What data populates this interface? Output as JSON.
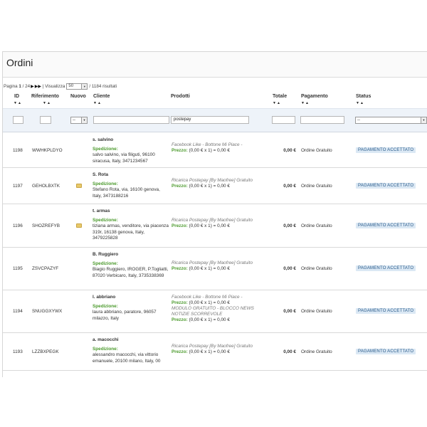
{
  "page": {
    "title": "Ordini"
  },
  "pagination": {
    "prefix": "Pagina",
    "current": "1",
    "total_suffix": "/ 24",
    "per_page_label": "| Visualizza",
    "per_page_value": "50",
    "results": "/ 1184 risultati"
  },
  "columns": {
    "id": "ID",
    "ref": "Riferimento",
    "new": "Nuovo",
    "customer": "Cliente",
    "products": "Prodotti",
    "total": "Totale",
    "payment": "Pagamento",
    "status": "Status",
    "sort_glyph": "▼▲"
  },
  "filters": {
    "new_value": "--",
    "products_value": "postepay",
    "status_value": "--"
  },
  "orders": [
    {
      "id": "1198",
      "ref": "WWHKPLDYO",
      "new": false,
      "customer_name": "s. salvino",
      "ship_label": "Spedizione:",
      "address": "salvo salvino, via filiguti, 96100 siracusa, Italy, 3471234567",
      "products": [
        {
          "name": "Facebook Like - Bottone Mi Piace -",
          "price_label": "Prezzo:",
          "price": "(0,00 € x 1) = 0,00 €"
        }
      ],
      "total": "0,00 €",
      "payment": "Ordine Gratuito",
      "status": "PAGAMENTO ACCETTATO"
    },
    {
      "id": "1197",
      "ref": "GEHOLBXTK",
      "new": true,
      "customer_name": "S. Rota",
      "ship_label": "Spedizione:",
      "address": "Stefano Rota, via, 16100 genova, Italy, 3473188216",
      "products": [
        {
          "name": "Ricarica Postepay [By Maofree] Gratuito",
          "price_label": "Prezzo:",
          "price": "(0,00 € x 1) = 0,00 €"
        }
      ],
      "total": "0,00 €",
      "payment": "Ordine Gratuito",
      "status": "PAGAMENTO ACCETTATO"
    },
    {
      "id": "1196",
      "ref": "SHOZREFYB",
      "new": true,
      "customer_name": "t. armas",
      "ship_label": "Spedizione:",
      "address": "tiziana armas, venditore, via piacenza 319r, 16138 genova, Italy, 3479225828",
      "products": [
        {
          "name": "Ricarica Postepay [By Maofree] Gratuito",
          "price_label": "Prezzo:",
          "price": "(0,00 € x 1) = 0,00 €"
        }
      ],
      "total": "0,00 €",
      "payment": "Ordine Gratuito",
      "status": "PAGAMENTO ACCETTATO"
    },
    {
      "id": "1195",
      "ref": "ZSVCPAZYF",
      "new": false,
      "customer_name": "B. Ruggiero",
      "ship_label": "Spedizione:",
      "address": "Biagio Ruggiero, IROGER, P.Togliatti, 87020 Verbicaro, Italy, 3735338369",
      "products": [
        {
          "name": "Ricarica Postepay [By Maofree] Gratuito",
          "price_label": "Prezzo:",
          "price": "(0,00 € x 1) = 0,00 €"
        }
      ],
      "total": "0,00 €",
      "payment": "Ordine Gratuito",
      "status": "PAGAMENTO ACCETTATO"
    },
    {
      "id": "1194",
      "ref": "SNUGGXYWX",
      "new": false,
      "customer_name": "l. abbriano",
      "ship_label": "Spedizione:",
      "address": "laura abbriano, paratore, 96057 milazzo, Italy",
      "products": [
        {
          "name": "Facebook Like - Bottone Mi Piace -",
          "price_label": "Prezzo:",
          "price": "(0,00 € x 1) = 0,00 €"
        },
        {
          "name": "MODULO GRATUITO - BLOCCO NEWS NOTIZIE SCORREVOLE",
          "price_label": "Prezzo:",
          "price": "(0,00 € x 1) = 0,00 €"
        }
      ],
      "total": "0,00 €",
      "payment": "Ordine Gratuito",
      "status": "PAGAMENTO ACCETTATO"
    },
    {
      "id": "1193",
      "ref": "LZZBXPEGK",
      "new": false,
      "customer_name": "a. macocchi",
      "ship_label": "Spedizione:",
      "address": "alessandro macocchi, via vittorio emanuele, 20100 milano, Italy, 00",
      "products": [
        {
          "name": "Ricarica Postepay [By Maofree] Gratuito",
          "price_label": "Prezzo:",
          "price": "(0,00 € x 1) = 0,00 €"
        }
      ],
      "total": "0,00 €",
      "payment": "Ordine Gratuito",
      "status": "PAGAMENTO ACCETTATO"
    }
  ]
}
